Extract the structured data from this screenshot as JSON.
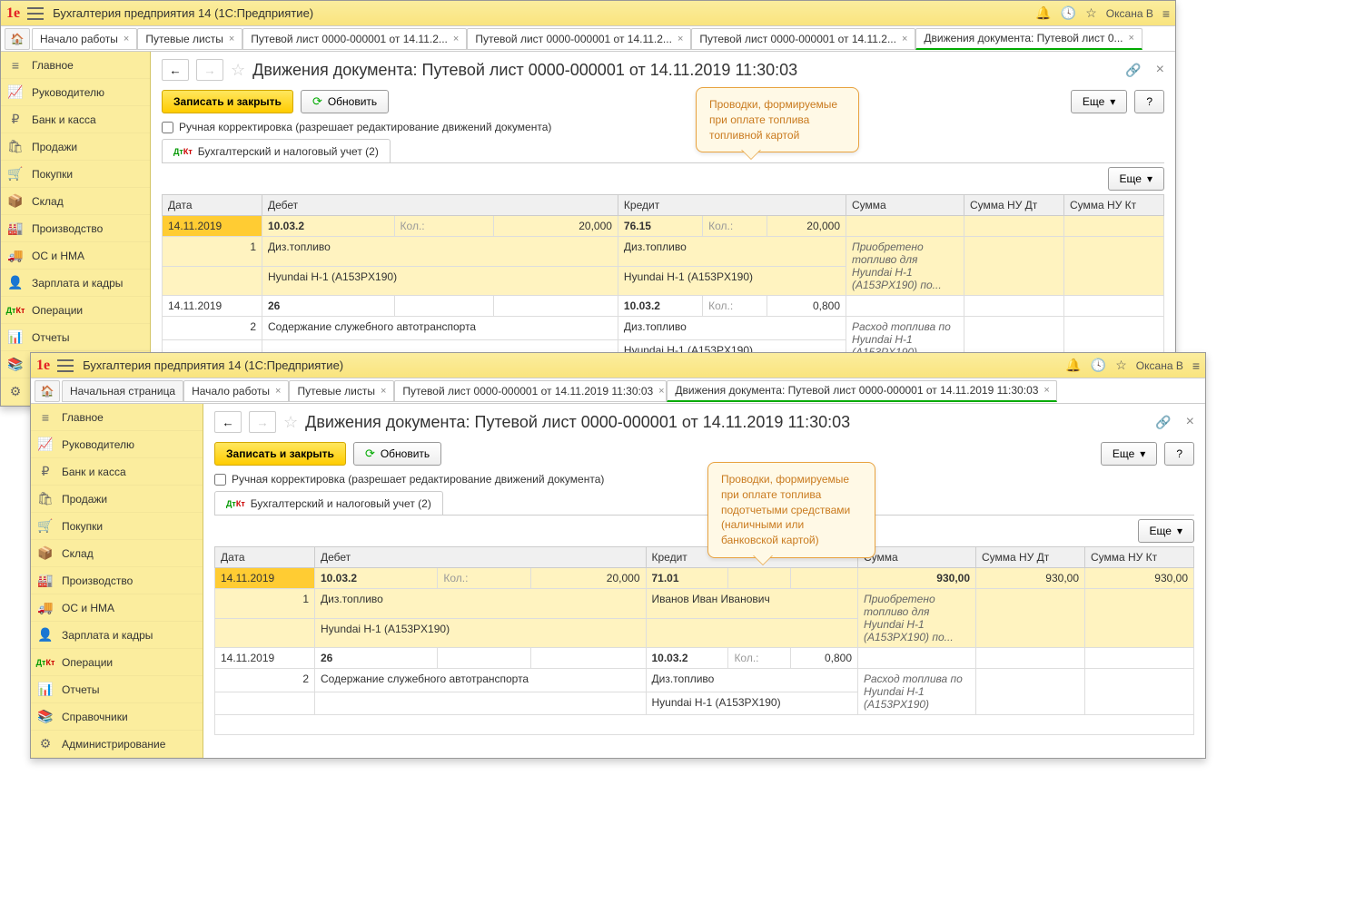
{
  "win1": {
    "title": "Бухгалтерия предприятия 14  (1С:Предприятие)",
    "user": "Оксана В",
    "tabs": [
      {
        "label": "Начало работы"
      },
      {
        "label": "Путевые листы"
      },
      {
        "label": "Путевой лист 0000-000001 от 14.11.2..."
      },
      {
        "label": "Путевой лист 0000-000001 от 14.11.2..."
      },
      {
        "label": "Путевой лист 0000-000001 от 14.11.2..."
      },
      {
        "label": "Движения документа: Путевой лист 0..."
      }
    ],
    "sidebar": [
      "Главное",
      "Руководителю",
      "Банк и касса",
      "Продажи",
      "Покупки",
      "Склад",
      "Производство",
      "ОС и НМА",
      "Зарплата и кадры",
      "Операции",
      "Отчеты",
      "Справочники"
    ],
    "gear": "⚙",
    "page_title": "Движения документа: Путевой лист 0000-000001 от 14.11.2019 11:30:03",
    "btn_save": "Записать и закрыть",
    "btn_refresh": "Обновить",
    "btn_more": "Еще",
    "checkbox_label": "Ручная корректировка (разрешает редактирование движений документа)",
    "tab_reg": "Бухгалтерский и налоговый учет (2)",
    "headers": {
      "date": "Дата",
      "debit": "Дебет",
      "credit": "Кредит",
      "sum": "Сумма",
      "sum_nu_dt": "Сумма НУ Дт",
      "sum_nu_kt": "Сумма НУ Кт",
      "qty": "Кол.:"
    },
    "rows": [
      {
        "date": "14.11.2019",
        "n": "1",
        "d_acc": "10.03.2",
        "d_qty": "20,000",
        "d_sub1": "Диз.топливо",
        "d_sub2": "Hyundai H-1 (A153PX190)",
        "c_acc": "76.15",
        "c_qty": "20,000",
        "c_sub1": "Диз.топливо",
        "c_sub2": "Hyundai H-1 (A153PX190)",
        "desc": "Приобретено топливо для Hyundai H-1 (A153PX190) по..."
      },
      {
        "date": "14.11.2019",
        "n": "2",
        "d_acc": "26",
        "d_sub1": "Содержание служебного автотранспорта",
        "c_acc": "10.03.2",
        "c_qty": "0,800",
        "c_sub1": "Диз.топливо",
        "c_sub2": "Hyundai H-1 (A153PX190)",
        "desc": "Расход топлива по Hyundai H-1 (A153PX190)"
      }
    ],
    "callout": "Проводки, формируемые при оплате топлива топливной картой"
  },
  "win2": {
    "title": "Бухгалтерия предприятия 14  (1С:Предприятие)",
    "user": "Оксана В",
    "home_tab": "Начальная страница",
    "tabs": [
      {
        "label": "Начало работы"
      },
      {
        "label": "Путевые листы"
      },
      {
        "label": "Путевой лист 0000-000001 от 14.11.2019 11:30:03"
      },
      {
        "label": "Движения документа: Путевой лист 0000-000001 от 14.11.2019 11:30:03"
      }
    ],
    "sidebar": [
      "Главное",
      "Руководителю",
      "Банк и касса",
      "Продажи",
      "Покупки",
      "Склад",
      "Производство",
      "ОС и НМА",
      "Зарплата и кадры",
      "Операции",
      "Отчеты",
      "Справочники",
      "Администрирование"
    ],
    "page_title": "Движения документа: Путевой лист 0000-000001 от 14.11.2019 11:30:03",
    "btn_save": "Записать и закрыть",
    "btn_refresh": "Обновить",
    "btn_more": "Еще",
    "checkbox_label": "Ручная корректировка (разрешает редактирование движений документа)",
    "tab_reg": "Бухгалтерский и налоговый учет (2)",
    "headers": {
      "date": "Дата",
      "debit": "Дебет",
      "credit": "Кредит",
      "sum": "Сумма",
      "sum_nu_dt": "Сумма НУ Дт",
      "sum_nu_kt": "Сумма НУ Кт",
      "qty": "Кол.:"
    },
    "rows": [
      {
        "date": "14.11.2019",
        "n": "1",
        "d_acc": "10.03.2",
        "d_qty": "20,000",
        "d_sub1": "Диз.топливо",
        "d_sub2": "Hyundai H-1 (A153PX190)",
        "c_acc": "71.01",
        "c_sub1": "Иванов Иван Иванович",
        "sum": "930,00",
        "sum_nu_dt": "930,00",
        "sum_nu_kt": "930,00",
        "desc": "Приобретено топливо для Hyundai H-1 (A153PX190) по..."
      },
      {
        "date": "14.11.2019",
        "n": "2",
        "d_acc": "26",
        "d_sub1": "Содержание служебного автотранспорта",
        "c_acc": "10.03.2",
        "c_qty": "0,800",
        "c_sub1": "Диз.топливо",
        "c_sub2": "Hyundai H-1 (A153PX190)",
        "desc": "Расход топлива по Hyundai H-1 (A153PX190)"
      }
    ],
    "callout": "Проводки, формируемые при оплате топлива подотчетыми средствами (наличными или банковской картой)"
  }
}
